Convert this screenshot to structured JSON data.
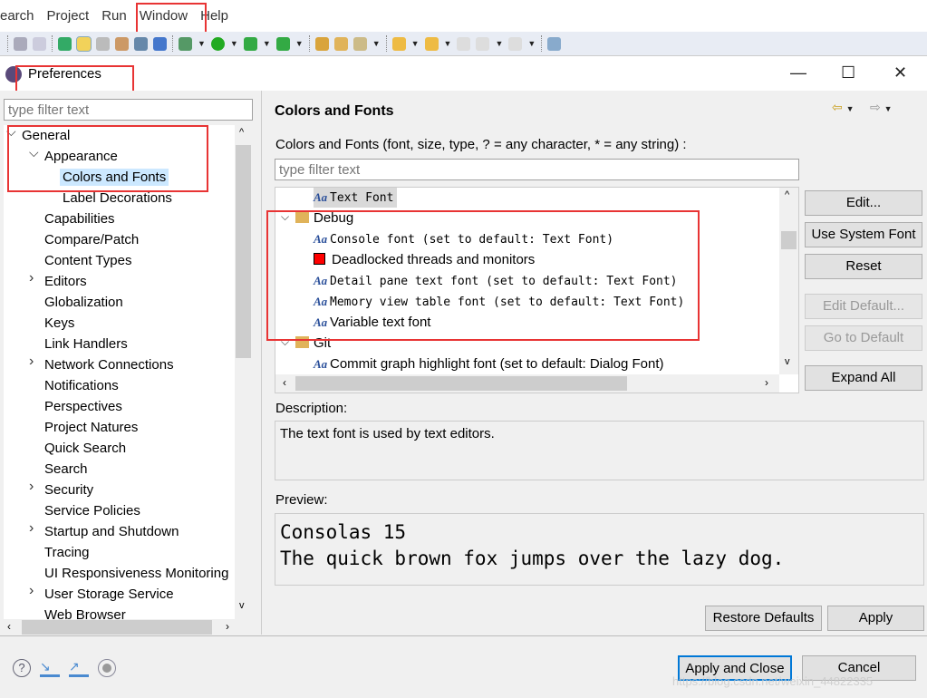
{
  "menubar": [
    "earch",
    "Project",
    "Run",
    "Window",
    "Help"
  ],
  "dialog": {
    "title": "Preferences",
    "minimize": "—",
    "maximize": "☐",
    "close": "✕"
  },
  "left": {
    "filter_placeholder": "type filter text",
    "tree": [
      {
        "label": "General",
        "level": 0,
        "expander": "open"
      },
      {
        "label": "Appearance",
        "level": 1,
        "expander": "open"
      },
      {
        "label": "Colors and Fonts",
        "level": 2,
        "selected": true
      },
      {
        "label": "Label Decorations",
        "level": 2
      },
      {
        "label": "Capabilities",
        "level": 1
      },
      {
        "label": "Compare/Patch",
        "level": 1
      },
      {
        "label": "Content Types",
        "level": 1
      },
      {
        "label": "Editors",
        "level": 1,
        "expander": "closed"
      },
      {
        "label": "Globalization",
        "level": 1
      },
      {
        "label": "Keys",
        "level": 1
      },
      {
        "label": "Link Handlers",
        "level": 1
      },
      {
        "label": "Network Connections",
        "level": 1,
        "expander": "closed"
      },
      {
        "label": "Notifications",
        "level": 1
      },
      {
        "label": "Perspectives",
        "level": 1
      },
      {
        "label": "Project Natures",
        "level": 1
      },
      {
        "label": "Quick Search",
        "level": 1
      },
      {
        "label": "Search",
        "level": 1
      },
      {
        "label": "Security",
        "level": 1,
        "expander": "closed"
      },
      {
        "label": "Service Policies",
        "level": 1
      },
      {
        "label": "Startup and Shutdown",
        "level": 1,
        "expander": "closed"
      },
      {
        "label": "Tracing",
        "level": 1
      },
      {
        "label": "UI Responsiveness Monitoring",
        "level": 1
      },
      {
        "label": "User Storage Service",
        "level": 1,
        "expander": "closed"
      },
      {
        "label": "Web Browser",
        "level": 1
      }
    ]
  },
  "main": {
    "title": "Colors and Fonts",
    "subtitle": "Colors and Fonts (font, size, type, ? = any character, * = any string) :",
    "filter_placeholder": "type filter text",
    "list": [
      {
        "label": "Text Font",
        "level": 2,
        "icon": "font",
        "mono": true,
        "selected": true
      },
      {
        "label": "Debug",
        "level": 1,
        "icon": "folder",
        "expander": "open"
      },
      {
        "label": "Console font (set to default: Text Font)",
        "level": 2,
        "icon": "font",
        "mono": true
      },
      {
        "label": "Deadlocked threads and monitors",
        "level": 2,
        "icon": "color",
        "color": "#ff0000"
      },
      {
        "label": "Detail pane text font (set to default: Text Font)",
        "level": 2,
        "icon": "font",
        "mono": true
      },
      {
        "label": "Memory view table font (set to default: Text Font)",
        "level": 2,
        "icon": "font",
        "mono": true
      },
      {
        "label": "Variable text font",
        "level": 2,
        "icon": "font"
      },
      {
        "label": "Git",
        "level": 1,
        "icon": "folder",
        "expander": "open"
      },
      {
        "label": "Commit graph highlight font (set to default: Dialog Font)",
        "level": 2,
        "icon": "font"
      }
    ],
    "buttons": {
      "edit": "Edit...",
      "system_font": "Use System Font",
      "reset": "Reset",
      "edit_default": "Edit Default...",
      "go_default": "Go to Default",
      "expand_all": "Expand All"
    },
    "description_label": "Description:",
    "description": "The text font is used by text editors.",
    "preview_label": "Preview:",
    "preview_line1": "Consolas 15",
    "preview_line2": "The quick brown fox jumps over the lazy dog.",
    "restore_defaults": "Restore Defaults",
    "apply": "Apply"
  },
  "footer": {
    "apply_close": "Apply and Close",
    "cancel": "Cancel"
  },
  "watermark": "https://blog.csdn.net/weixin_44822335",
  "colors": {
    "annotation": "#e83434",
    "selection": "#cce8ff"
  }
}
